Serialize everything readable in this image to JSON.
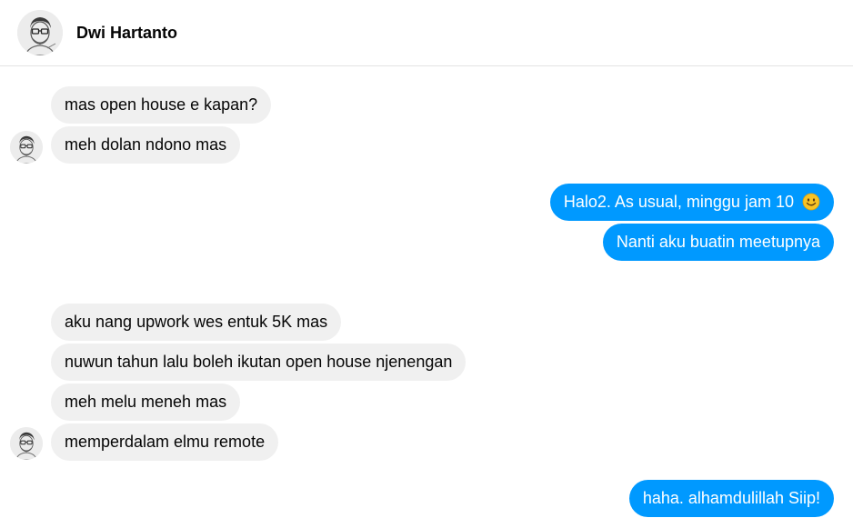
{
  "header": {
    "contact_name": "Dwi Hartanto",
    "avatar_icon": "sketch-avatar-icon"
  },
  "colors": {
    "incoming_bubble": "#f0f0f0",
    "outgoing_bubble": "#0099ff",
    "divider": "#e4e4e4"
  },
  "messages": [
    {
      "direction": "incoming",
      "text": "mas open house e kapan?"
    },
    {
      "direction": "incoming",
      "text": "meh dolan ndono mas"
    },
    {
      "direction": "outgoing",
      "text": "Halo2. As usual, minggu jam 10",
      "emoji": "smiley-emoji-icon"
    },
    {
      "direction": "outgoing",
      "text": "Nanti aku buatin meetupnya"
    },
    {
      "direction": "incoming",
      "text": "aku nang upwork wes entuk 5K mas"
    },
    {
      "direction": "incoming",
      "text": "nuwun tahun lalu boleh ikutan open house njenengan"
    },
    {
      "direction": "incoming",
      "text": "meh melu meneh mas"
    },
    {
      "direction": "incoming",
      "text": "memperdalam elmu remote"
    },
    {
      "direction": "outgoing",
      "text": "haha. alhamdulillah Siip!"
    }
  ]
}
